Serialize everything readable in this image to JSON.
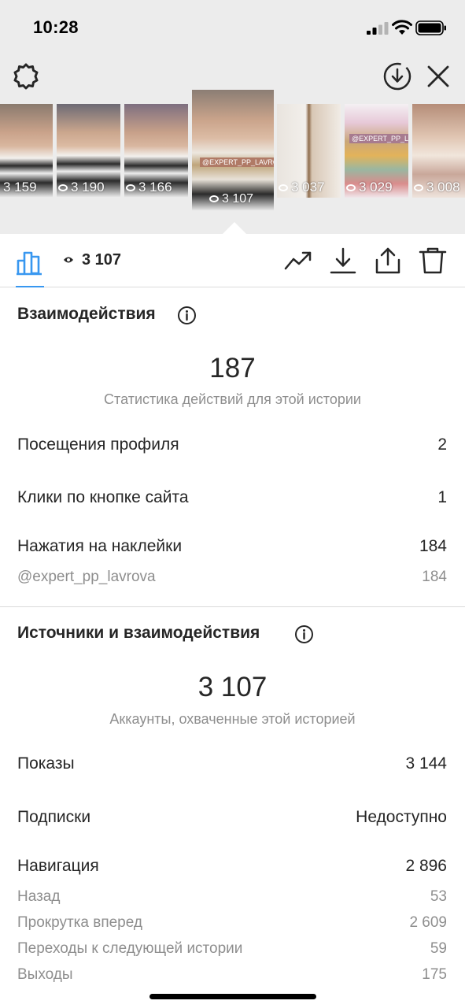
{
  "status_bar": {
    "time": "10:28"
  },
  "story_strip": {
    "thumbnails": [
      {
        "views": "3 159",
        "selected": false
      },
      {
        "views": "3 190",
        "selected": false
      },
      {
        "views": "3 166",
        "selected": false
      },
      {
        "views": "3 107",
        "selected": true,
        "overlay_text": "@EXPERT_PP_LAVROVA"
      },
      {
        "views": "3 037",
        "selected": false
      },
      {
        "views": "3 029",
        "selected": false,
        "overlay_text": "@EXPERT_PP_LAVROVA"
      },
      {
        "views": "3 008",
        "selected": false
      }
    ]
  },
  "toolbar": {
    "views": "3 107"
  },
  "interactions": {
    "title": "Взаимодействия",
    "total": "187",
    "caption": "Статистика действий для этой истории",
    "rows": [
      {
        "label": "Посещения профиля",
        "value": "2"
      },
      {
        "label": "Клики по кнопке сайта",
        "value": "1"
      },
      {
        "label": "Нажатия на наклейки",
        "value": "184"
      }
    ],
    "sticker": {
      "label": "@expert_pp_lavrova",
      "value": "184"
    }
  },
  "discovery": {
    "title": "Источники и взаимодействия",
    "total": "3 107",
    "caption": "Аккаунты, охваченные этой историей",
    "rows": [
      {
        "label": "Показы",
        "value": "3 144"
      },
      {
        "label": "Подписки",
        "value": "Недоступно"
      },
      {
        "label": "Навигация",
        "value": "2 896"
      }
    ],
    "navigation": [
      {
        "label": "Назад",
        "value": "53"
      },
      {
        "label": "Прокрутка вперед",
        "value": "2 609"
      },
      {
        "label": "Переходы к следующей истории",
        "value": "59"
      },
      {
        "label": "Выходы",
        "value": "175"
      }
    ]
  },
  "colors": {
    "accent": "#3897f0",
    "text": "#262626",
    "muted": "#8e8e8e",
    "top_bg": "#ececec"
  },
  "icons": [
    "settings-icon",
    "download-icon",
    "close-icon",
    "bar-chart-icon",
    "eye-icon",
    "trending-icon",
    "save-icon",
    "share-icon",
    "trash-icon",
    "info-icon"
  ]
}
